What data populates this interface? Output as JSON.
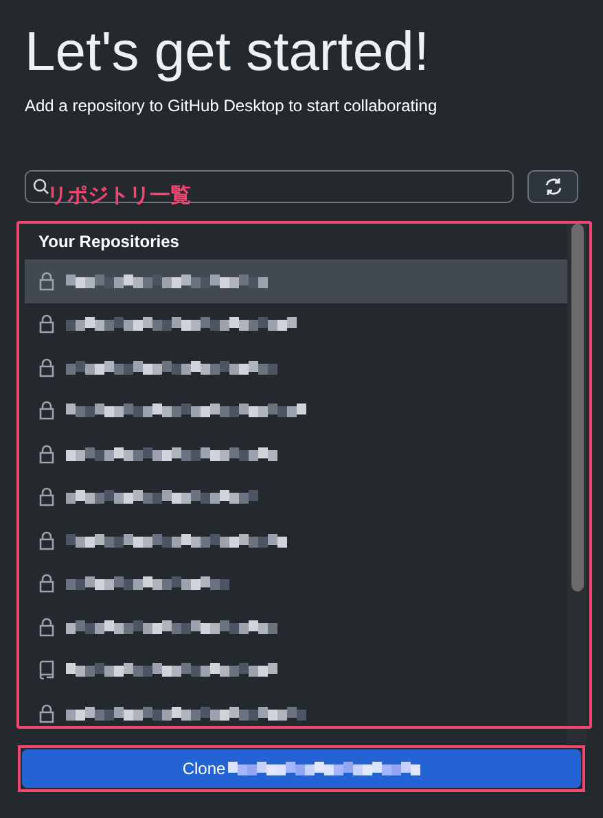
{
  "title": "Let's get started!",
  "subtitle": "Add a repository to GitHub Desktop to start collaborating",
  "annotation": {
    "label": "リポジトリ一覧"
  },
  "list": {
    "heading": "Your Repositories",
    "items": [
      {
        "kind": "private",
        "selected": true
      },
      {
        "kind": "private",
        "selected": false
      },
      {
        "kind": "private",
        "selected": false
      },
      {
        "kind": "private",
        "selected": false
      },
      {
        "kind": "private",
        "selected": false
      },
      {
        "kind": "private",
        "selected": false
      },
      {
        "kind": "private",
        "selected": false
      },
      {
        "kind": "private",
        "selected": false
      },
      {
        "kind": "private",
        "selected": false
      },
      {
        "kind": "public",
        "selected": false
      },
      {
        "kind": "private",
        "selected": false
      }
    ]
  },
  "clone_button": {
    "label": "Clone"
  }
}
